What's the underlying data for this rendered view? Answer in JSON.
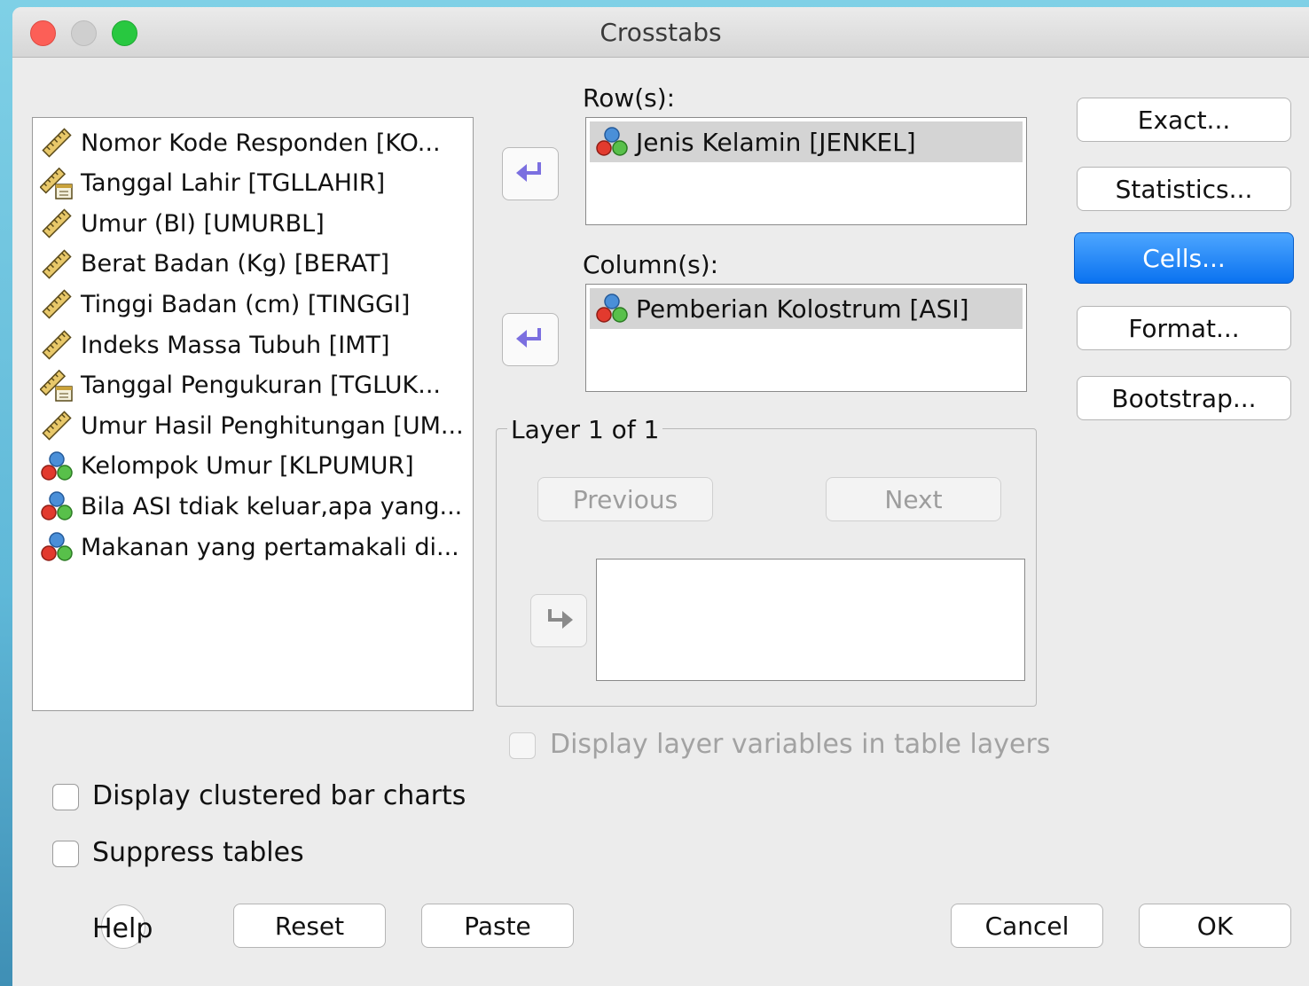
{
  "window": {
    "title": "Crosstabs"
  },
  "variables": [
    {
      "label": "Nomor Kode Responden [KO...",
      "icon": "ruler-scale-icon"
    },
    {
      "label": "Tanggal Lahir [TGLLAHIR]",
      "icon": "date-ruler-icon"
    },
    {
      "label": "Umur (Bl) [UMURBL]",
      "icon": "ruler-scale-icon"
    },
    {
      "label": "Berat Badan (Kg) [BERAT]",
      "icon": "ruler-scale-icon"
    },
    {
      "label": "Tinggi Badan (cm) [TINGGI]",
      "icon": "ruler-scale-icon"
    },
    {
      "label": "Indeks Massa Tubuh [IMT]",
      "icon": "ruler-scale-icon"
    },
    {
      "label": "Tanggal Pengukuran [TGLUK...",
      "icon": "date-ruler-icon"
    },
    {
      "label": "Umur Hasil Penghitungan [UM...",
      "icon": "ruler-scale-icon"
    },
    {
      "label": "Kelompok Umur [KLPUMUR]",
      "icon": "nominal-balls-icon"
    },
    {
      "label": "Bila ASI tdiak keluar,apa yang...",
      "icon": "nominal-balls-icon"
    },
    {
      "label": "Makanan yang pertamakali di...",
      "icon": "nominal-balls-icon"
    }
  ],
  "rows": {
    "label": "Row(s):",
    "selected": "Jenis Kelamin [JENKEL]"
  },
  "columns": {
    "label": "Column(s):",
    "selected": "Pemberian Kolostrum [ASI]"
  },
  "layer": {
    "legend": "Layer 1 of 1",
    "previous_label": "Previous",
    "next_label": "Next"
  },
  "side_buttons": {
    "exact": "Exact...",
    "statistics": "Statistics...",
    "cells": "Cells...",
    "format": "Format...",
    "bootstrap": "Bootstrap..."
  },
  "checkboxes": {
    "layer_vars": "Display layer variables in table layers",
    "clustered": "Display clustered bar charts",
    "suppress": "Suppress tables"
  },
  "footer": {
    "help": "Help",
    "reset": "Reset",
    "paste": "Paste",
    "cancel": "Cancel",
    "ok": "OK"
  },
  "colors": {
    "accent": "#0a72f0",
    "arrow": "#7b6fe0"
  }
}
